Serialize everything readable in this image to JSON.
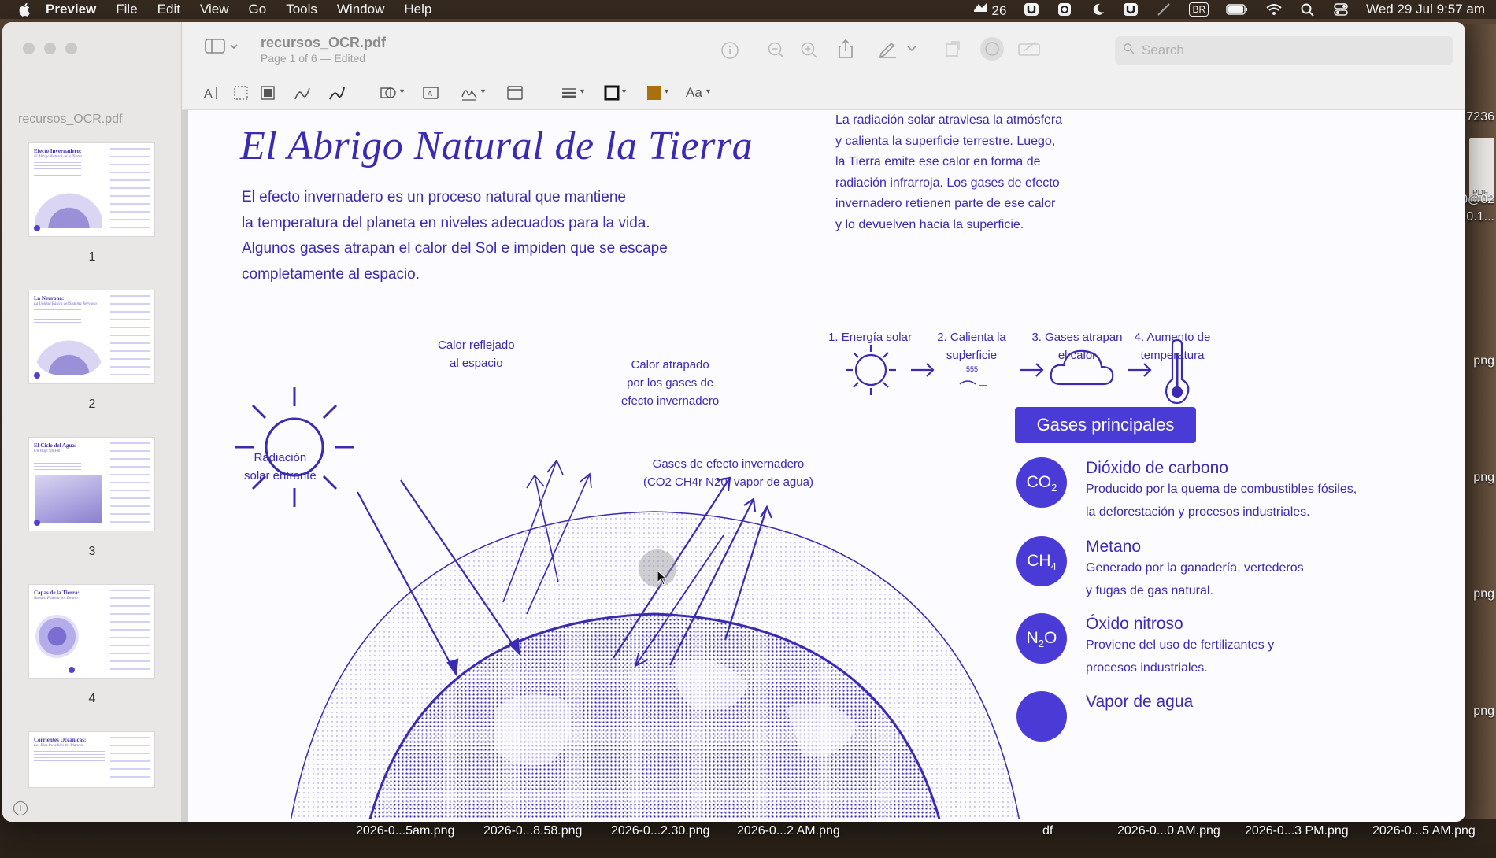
{
  "menubar": {
    "app": "Preview",
    "items": [
      "File",
      "Edit",
      "View",
      "Go",
      "Tools",
      "Window",
      "Help"
    ],
    "status_count": "26",
    "input_source": "BR",
    "datetime": "Wed 29 Jul  9:57 am"
  },
  "sidebar": {
    "filename": "recursos_OCR.pdf",
    "thumbnails": [
      {
        "num": "1",
        "title": "Efecto Invernadero:",
        "subtitle": "El Abrigo Natural de la Tierra"
      },
      {
        "num": "2",
        "title": "La Neurona:",
        "subtitle": "La Unidad Básica del Sistema Nervioso"
      },
      {
        "num": "3",
        "title": "El Ciclo del Agua:",
        "subtitle": "Un Viaje Sin Fin"
      },
      {
        "num": "4",
        "title": "Capas de la Tierra:",
        "subtitle": "Nuestro Planeta por Dentro"
      },
      {
        "num": "5",
        "title": "Corrientes Oceánicas:",
        "subtitle": "Los Ríos Invisibles del Planeta"
      }
    ]
  },
  "toolbar": {
    "doc_title": "recursos_OCR.pdf",
    "doc_subtitle": "Page 1 of 6 — Edited",
    "search_placeholder": "Search",
    "font_button": "Aa"
  },
  "page": {
    "title": "El Abrigo Natural de la Tierra",
    "intro_lines": [
      "El efecto invernadero es un proceso natural que mantiene",
      "la temperatura del planeta en niveles adecuados para la vida.",
      "Algunos gases atrapan el calor del Sol e impiden que se escape",
      "completamente al espacio."
    ],
    "right_lines": [
      "La radiación solar atraviesa la atmósfera",
      "y calienta la superficie terrestre. Luego,",
      "la Tierra emite ese calor en forma de",
      "radiación infrarroja. Los gases de efecto",
      "invernadero retienen parte de ese calor",
      "y lo devuelven hacia la superficie."
    ],
    "steps": [
      {
        "line1": "1. Energía solar",
        "line2": ""
      },
      {
        "line1": "2. Calienta la",
        "line2": "superficie"
      },
      {
        "line1": "3. Gases atrapan",
        "line2": "el calor"
      },
      {
        "line1": "4. Aumento de",
        "line2": "temperatura"
      }
    ],
    "diagram_labels": {
      "reflected_1": "Calor reflejado",
      "reflected_2": "al espacio",
      "trapped_1": "Calor atrapado",
      "trapped_2": "por los gases de",
      "trapped_3": "efecto invernadero",
      "radiation_1": "Radiación",
      "radiation_2": "solar entrante",
      "gases_1": "Gases de efecto invernadero",
      "gases_2": "(CO2 CH4r N20, vapor de agua)"
    },
    "gases_heading": "Gases principales",
    "gases": [
      {
        "formula": "CO",
        "sub": "2",
        "name": "Dióxido de carbono",
        "desc1": "Producido por la quema de combustibles fósiles,",
        "desc2": "la deforestación y procesos industriales."
      },
      {
        "formula": "CH",
        "sub": "4",
        "name": "Metano",
        "desc1": "Generado por la ganadería, vertederos",
        "desc2": "y fugas de gas natural."
      },
      {
        "formula": "N",
        "sub": "2",
        "formula_end": "O",
        "name": "Óxido nitroso",
        "desc1": "Proviene del uso de fertilizantes y",
        "desc2": "procesos industriales."
      },
      {
        "formula": "",
        "sub": "",
        "name": "Vapor de agua",
        "desc1": "",
        "desc2": ""
      }
    ]
  },
  "desktop": {
    "right_labels": [
      "7236",
      "PDF",
      "0@02",
      "0.1...",
      "png",
      "png",
      "png",
      "png"
    ],
    "dock_files": [
      "2026-0...5am.png",
      "2026-0...8.58.png",
      "2026-0...2.30.png",
      "2026-0...2 AM.png",
      "df",
      "2026-0...0 AM.png",
      "2026-0...3 PM.png",
      "2026-0...5 AM.png"
    ]
  },
  "colors": {
    "ink": "#3a2bb0",
    "accent": "#4a3bd6",
    "page_bg": "#fcfbff"
  }
}
